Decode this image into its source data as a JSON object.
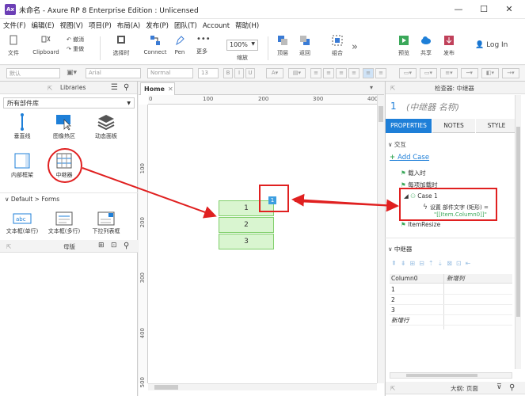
{
  "window": {
    "title": "未命名 - Axure RP 8 Enterprise Edition : Unlicensed",
    "app_icon": "Ax",
    "controls": [
      "—",
      "☐",
      "✕"
    ]
  },
  "menu": [
    "文件(F)",
    "编辑(E)",
    "视图(V)",
    "项目(P)",
    "布局(A)",
    "发布(P)",
    "团队(T)",
    "Account",
    "帮助(H)"
  ],
  "toolbar": {
    "file": "文件",
    "clipboard": "Clipboard",
    "undo": "撤消",
    "redo": "重做",
    "select": "选择时",
    "connect": "Connect",
    "pen": "Pen",
    "more": "更多",
    "zoom_value": "100%",
    "zoom_label": "缩放",
    "top": "顶层",
    "back": "返回",
    "group": "组合",
    "preview": "预览",
    "share": "共享",
    "publish": "发布",
    "login": "Log In"
  },
  "formatbar": {
    "style": "默认",
    "font": "Arial",
    "weight": "Normal",
    "size": "13"
  },
  "libraries": {
    "title": "Libraries",
    "selector": "所有部件库",
    "items_row1": [
      "垂直线",
      "图像热区",
      "动态面板"
    ],
    "items_row2": [
      "内部框架",
      "中继器"
    ],
    "forms_header": "Default > Forms",
    "forms": [
      "文本框(单行)",
      "文本框(多行)",
      "下拉列表框"
    ],
    "masters_title": "母版"
  },
  "canvas": {
    "tab": "Home",
    "ruler_h": [
      "0",
      "100",
      "200",
      "300",
      "400"
    ],
    "ruler_v": [
      "100",
      "200",
      "300",
      "400",
      "500"
    ],
    "repeater_badge": "1",
    "rows": [
      "1",
      "2",
      "3"
    ]
  },
  "inspector": {
    "title": "检查器: 中继器",
    "index": "1",
    "name": "(中继器 名称)",
    "tabs": [
      "PROPERTIES",
      "NOTES",
      "STYLE"
    ],
    "interaction_header": "交互",
    "add_case": "Add Case",
    "events": [
      "载入时",
      "每项加载时"
    ],
    "case_name": "Case 1",
    "action": "设置 部件文字 (矩形) =",
    "action_value": "\"[[Item.Column0]]\"",
    "event3": "ItemResize",
    "repeater_header": "中继器",
    "grid_headers": [
      "Column0",
      "新增列"
    ],
    "grid_rows": [
      "1",
      "2",
      "3"
    ],
    "new_row": "新增行",
    "outline": "大纲: 页面"
  },
  "colors": {
    "accent": "#1e7fd8",
    "highlight": "#e02020",
    "repeater_fill": "#d9f5d0"
  }
}
